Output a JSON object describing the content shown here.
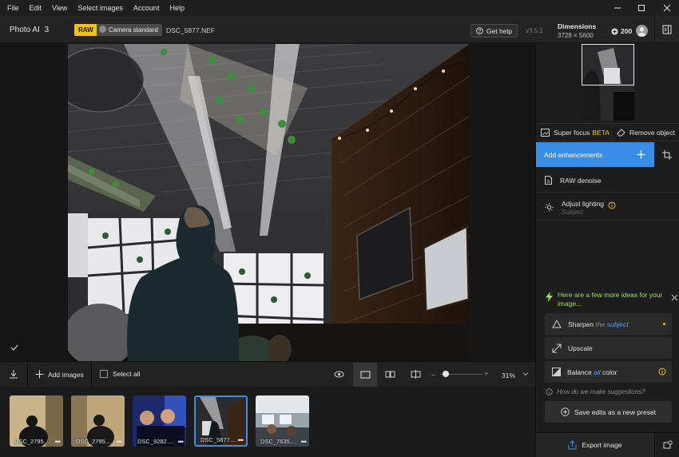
{
  "menubar": {
    "items": [
      "File",
      "Edit",
      "View",
      "Select images",
      "Account",
      "Help"
    ],
    "window_controls": [
      "minimize-icon",
      "maximize-icon",
      "close-icon"
    ]
  },
  "header": {
    "app_name": "Photo AI",
    "app_version_major": "3",
    "raw_badge": "RAW",
    "profile_badge": "Camera standard",
    "file_name": "DSC_5877.NEF",
    "help_label": "Get help",
    "version": "v3.5.1",
    "dimensions_label": "Dimensions",
    "dimensions_value": "3728 × 5600",
    "credits": "200"
  },
  "right_panel": {
    "super_focus_label": "Super focus",
    "super_focus_tag": "BETA",
    "remove_object_label": "Remove object",
    "add_enhancements_label": "Add enhancements",
    "enhancements": [
      {
        "label": "RAW denoise",
        "icon": "raw-icon"
      },
      {
        "label": "Adjust lighting",
        "sub": "Subject",
        "icon": "lighting-icon"
      }
    ],
    "ideas_header": "Here are a few more ideas for your image...",
    "ideas": [
      {
        "pre": "Sharpen",
        "mid": "the",
        "post": "subject",
        "icon": "sharpen-icon"
      },
      {
        "pre": "Upscale",
        "mid": "",
        "post": "",
        "icon": "upscale-icon"
      },
      {
        "pre": "Balance",
        "mid": "all",
        "post": "color",
        "icon": "balance-icon"
      }
    ],
    "suggestion_help": "How do we make suggestions?",
    "save_preset_label": "Save edits as a new preset",
    "export_label": "Export image"
  },
  "toolbar": {
    "add_images_label": "Add images",
    "select_all_label": "Select all",
    "zoom": "31%",
    "zoom_fraction": 0.05
  },
  "filmstrip": [
    {
      "name": "DSC_2795....",
      "selected": false
    },
    {
      "name": "DSC_2795....",
      "selected": false
    },
    {
      "name": "DSC_9282....",
      "selected": false
    },
    {
      "name": "DSC_5877....",
      "selected": true
    },
    {
      "name": "DSC_7635....",
      "selected": false
    }
  ],
  "colors": {
    "accent_blue": "#3a8ee6",
    "raw_yellow": "#f0c020",
    "ideas_green": "#9be15d"
  }
}
